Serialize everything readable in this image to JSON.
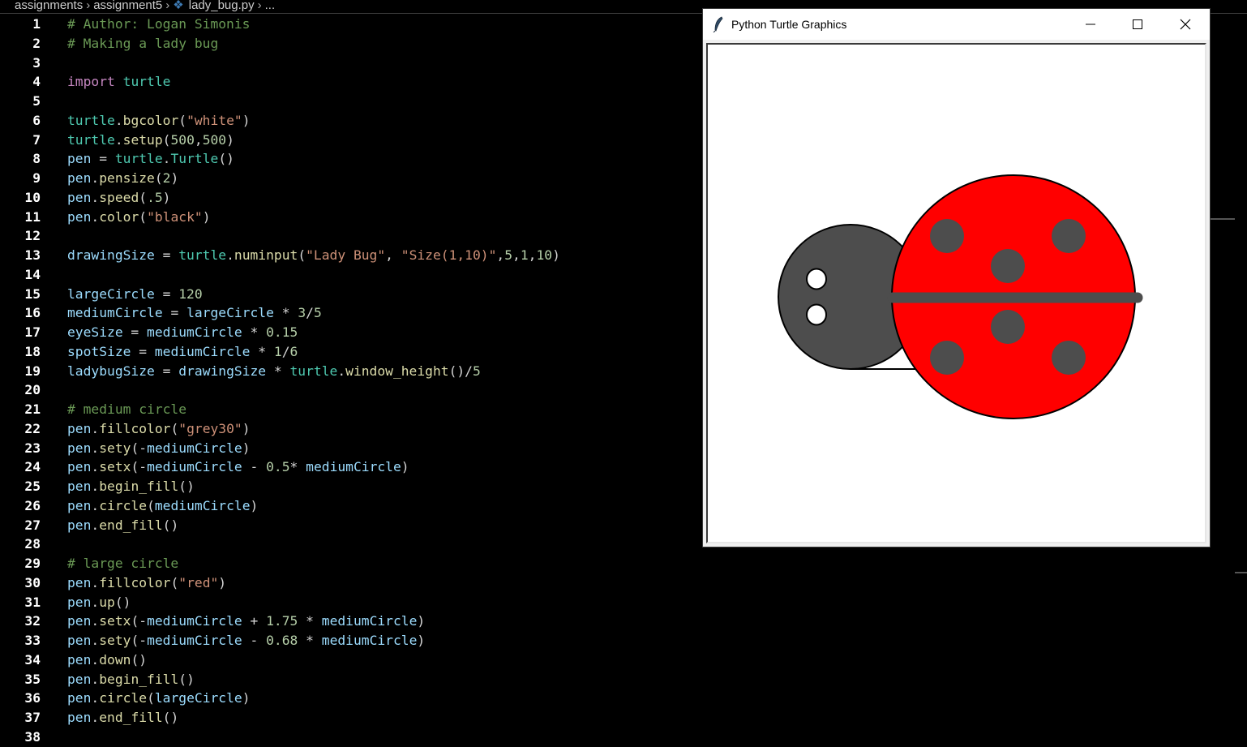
{
  "breadcrumb": {
    "items": [
      "assignments",
      "assignment5",
      "lady_bug.py",
      "..."
    ]
  },
  "editor": {
    "lines": [
      {
        "n": "1",
        "t": [
          [
            "com",
            "# Author: Logan Simonis"
          ]
        ]
      },
      {
        "n": "2",
        "t": [
          [
            "com",
            "# Making a lady bug"
          ]
        ]
      },
      {
        "n": "3",
        "t": []
      },
      {
        "n": "4",
        "t": [
          [
            "kw",
            "import"
          ],
          [
            "pun",
            " "
          ],
          [
            "mod",
            "turtle"
          ]
        ]
      },
      {
        "n": "5",
        "t": []
      },
      {
        "n": "6",
        "t": [
          [
            "mod",
            "turtle"
          ],
          [
            "pun",
            "."
          ],
          [
            "fn",
            "bgcolor"
          ],
          [
            "pun",
            "("
          ],
          [
            "str",
            "\"white\""
          ],
          [
            "pun",
            ")"
          ]
        ]
      },
      {
        "n": "7",
        "t": [
          [
            "mod",
            "turtle"
          ],
          [
            "pun",
            "."
          ],
          [
            "fn",
            "setup"
          ],
          [
            "pun",
            "("
          ],
          [
            "num",
            "500"
          ],
          [
            "pun",
            ","
          ],
          [
            "num",
            "500"
          ],
          [
            "pun",
            ")"
          ]
        ]
      },
      {
        "n": "8",
        "t": [
          [
            "var",
            "pen"
          ],
          [
            "pun",
            " = "
          ],
          [
            "mod",
            "turtle"
          ],
          [
            "pun",
            "."
          ],
          [
            "mod",
            "Turtle"
          ],
          [
            "pun",
            "()"
          ]
        ]
      },
      {
        "n": "9",
        "t": [
          [
            "var",
            "pen"
          ],
          [
            "pun",
            "."
          ],
          [
            "fn",
            "pensize"
          ],
          [
            "pun",
            "("
          ],
          [
            "num",
            "2"
          ],
          [
            "pun",
            ")"
          ]
        ]
      },
      {
        "n": "10",
        "t": [
          [
            "var",
            "pen"
          ],
          [
            "pun",
            "."
          ],
          [
            "fn",
            "speed"
          ],
          [
            "pun",
            "("
          ],
          [
            "num",
            ".5"
          ],
          [
            "pun",
            ")"
          ]
        ]
      },
      {
        "n": "11",
        "t": [
          [
            "var",
            "pen"
          ],
          [
            "pun",
            "."
          ],
          [
            "fn",
            "color"
          ],
          [
            "pun",
            "("
          ],
          [
            "str",
            "\"black\""
          ],
          [
            "pun",
            ")"
          ]
        ]
      },
      {
        "n": "12",
        "t": []
      },
      {
        "n": "13",
        "t": [
          [
            "var",
            "drawingSize"
          ],
          [
            "pun",
            " = "
          ],
          [
            "mod",
            "turtle"
          ],
          [
            "pun",
            "."
          ],
          [
            "fn",
            "numinput"
          ],
          [
            "pun",
            "("
          ],
          [
            "str",
            "\"Lady Bug\""
          ],
          [
            "pun",
            ", "
          ],
          [
            "str",
            "\"Size(1,10)\""
          ],
          [
            "pun",
            ","
          ],
          [
            "num",
            "5"
          ],
          [
            "pun",
            ","
          ],
          [
            "num",
            "1"
          ],
          [
            "pun",
            ","
          ],
          [
            "num",
            "10"
          ],
          [
            "pun",
            ")"
          ]
        ]
      },
      {
        "n": "14",
        "t": []
      },
      {
        "n": "15",
        "t": [
          [
            "var",
            "largeCircle"
          ],
          [
            "pun",
            " = "
          ],
          [
            "num",
            "120"
          ]
        ]
      },
      {
        "n": "16",
        "t": [
          [
            "var",
            "mediumCircle"
          ],
          [
            "pun",
            " = "
          ],
          [
            "var",
            "largeCircle"
          ],
          [
            "pun",
            " * "
          ],
          [
            "num",
            "3"
          ],
          [
            "pun",
            "/"
          ],
          [
            "num",
            "5"
          ]
        ]
      },
      {
        "n": "17",
        "t": [
          [
            "var",
            "eyeSize"
          ],
          [
            "pun",
            " = "
          ],
          [
            "var",
            "mediumCircle"
          ],
          [
            "pun",
            " * "
          ],
          [
            "num",
            "0.15"
          ]
        ]
      },
      {
        "n": "18",
        "t": [
          [
            "var",
            "spotSize"
          ],
          [
            "pun",
            " = "
          ],
          [
            "var",
            "mediumCircle"
          ],
          [
            "pun",
            " * "
          ],
          [
            "num",
            "1"
          ],
          [
            "pun",
            "/"
          ],
          [
            "num",
            "6"
          ]
        ]
      },
      {
        "n": "19",
        "t": [
          [
            "var",
            "ladybugSize"
          ],
          [
            "pun",
            " = "
          ],
          [
            "var",
            "drawingSize"
          ],
          [
            "pun",
            " * "
          ],
          [
            "mod",
            "turtle"
          ],
          [
            "pun",
            "."
          ],
          [
            "fn",
            "window_height"
          ],
          [
            "pun",
            "()/"
          ],
          [
            "num",
            "5"
          ]
        ]
      },
      {
        "n": "20",
        "t": []
      },
      {
        "n": "21",
        "t": [
          [
            "com",
            "# medium circle"
          ]
        ]
      },
      {
        "n": "22",
        "t": [
          [
            "var",
            "pen"
          ],
          [
            "pun",
            "."
          ],
          [
            "fn",
            "fillcolor"
          ],
          [
            "pun",
            "("
          ],
          [
            "str",
            "\"grey30\""
          ],
          [
            "pun",
            ")"
          ]
        ]
      },
      {
        "n": "23",
        "t": [
          [
            "var",
            "pen"
          ],
          [
            "pun",
            "."
          ],
          [
            "fn",
            "sety"
          ],
          [
            "pun",
            "(-"
          ],
          [
            "var",
            "mediumCircle"
          ],
          [
            "pun",
            ")"
          ]
        ]
      },
      {
        "n": "24",
        "t": [
          [
            "var",
            "pen"
          ],
          [
            "pun",
            "."
          ],
          [
            "fn",
            "setx"
          ],
          [
            "pun",
            "(-"
          ],
          [
            "var",
            "mediumCircle"
          ],
          [
            "pun",
            " - "
          ],
          [
            "num",
            "0.5"
          ],
          [
            "pun",
            "* "
          ],
          [
            "var",
            "mediumCircle"
          ],
          [
            "pun",
            ")"
          ]
        ]
      },
      {
        "n": "25",
        "t": [
          [
            "var",
            "pen"
          ],
          [
            "pun",
            "."
          ],
          [
            "fn",
            "begin_fill"
          ],
          [
            "pun",
            "()"
          ]
        ]
      },
      {
        "n": "26",
        "t": [
          [
            "var",
            "pen"
          ],
          [
            "pun",
            "."
          ],
          [
            "fn",
            "circle"
          ],
          [
            "pun",
            "("
          ],
          [
            "var",
            "mediumCircle"
          ],
          [
            "pun",
            ")"
          ]
        ]
      },
      {
        "n": "27",
        "t": [
          [
            "var",
            "pen"
          ],
          [
            "pun",
            "."
          ],
          [
            "fn",
            "end_fill"
          ],
          [
            "pun",
            "()"
          ]
        ]
      },
      {
        "n": "28",
        "t": []
      },
      {
        "n": "29",
        "t": [
          [
            "com",
            "# large circle"
          ]
        ]
      },
      {
        "n": "30",
        "t": [
          [
            "var",
            "pen"
          ],
          [
            "pun",
            "."
          ],
          [
            "fn",
            "fillcolor"
          ],
          [
            "pun",
            "("
          ],
          [
            "str",
            "\"red\""
          ],
          [
            "pun",
            ")"
          ]
        ]
      },
      {
        "n": "31",
        "t": [
          [
            "var",
            "pen"
          ],
          [
            "pun",
            "."
          ],
          [
            "fn",
            "up"
          ],
          [
            "pun",
            "()"
          ]
        ]
      },
      {
        "n": "32",
        "t": [
          [
            "var",
            "pen"
          ],
          [
            "pun",
            "."
          ],
          [
            "fn",
            "setx"
          ],
          [
            "pun",
            "(-"
          ],
          [
            "var",
            "mediumCircle"
          ],
          [
            "pun",
            " + "
          ],
          [
            "num",
            "1.75"
          ],
          [
            "pun",
            " * "
          ],
          [
            "var",
            "mediumCircle"
          ],
          [
            "pun",
            ")"
          ]
        ]
      },
      {
        "n": "33",
        "t": [
          [
            "var",
            "pen"
          ],
          [
            "pun",
            "."
          ],
          [
            "fn",
            "sety"
          ],
          [
            "pun",
            "(-"
          ],
          [
            "var",
            "mediumCircle"
          ],
          [
            "pun",
            " - "
          ],
          [
            "num",
            "0.68"
          ],
          [
            "pun",
            " * "
          ],
          [
            "var",
            "mediumCircle"
          ],
          [
            "pun",
            ")"
          ]
        ]
      },
      {
        "n": "34",
        "t": [
          [
            "var",
            "pen"
          ],
          [
            "pun",
            "."
          ],
          [
            "fn",
            "down"
          ],
          [
            "pun",
            "()"
          ]
        ]
      },
      {
        "n": "35",
        "t": [
          [
            "var",
            "pen"
          ],
          [
            "pun",
            "."
          ],
          [
            "fn",
            "begin_fill"
          ],
          [
            "pun",
            "()"
          ]
        ]
      },
      {
        "n": "36",
        "t": [
          [
            "var",
            "pen"
          ],
          [
            "pun",
            "."
          ],
          [
            "fn",
            "circle"
          ],
          [
            "pun",
            "("
          ],
          [
            "var",
            "largeCircle"
          ],
          [
            "pun",
            ")"
          ]
        ]
      },
      {
        "n": "37",
        "t": [
          [
            "var",
            "pen"
          ],
          [
            "pun",
            "."
          ],
          [
            "fn",
            "end_fill"
          ],
          [
            "pun",
            "()"
          ]
        ]
      },
      {
        "n": "38",
        "t": []
      }
    ]
  },
  "turtle_window": {
    "title": "Python Turtle Graphics",
    "icon": "feather-icon",
    "controls": [
      "minimize-icon",
      "maximize-icon",
      "close-icon"
    ],
    "drawing": {
      "background": "#ffffff",
      "head_color": "#4d4d4d",
      "body_color": "#ff0000",
      "spot_color": "#4d4d4d",
      "eye_color": "#ffffff",
      "outline_color": "#000000"
    }
  }
}
